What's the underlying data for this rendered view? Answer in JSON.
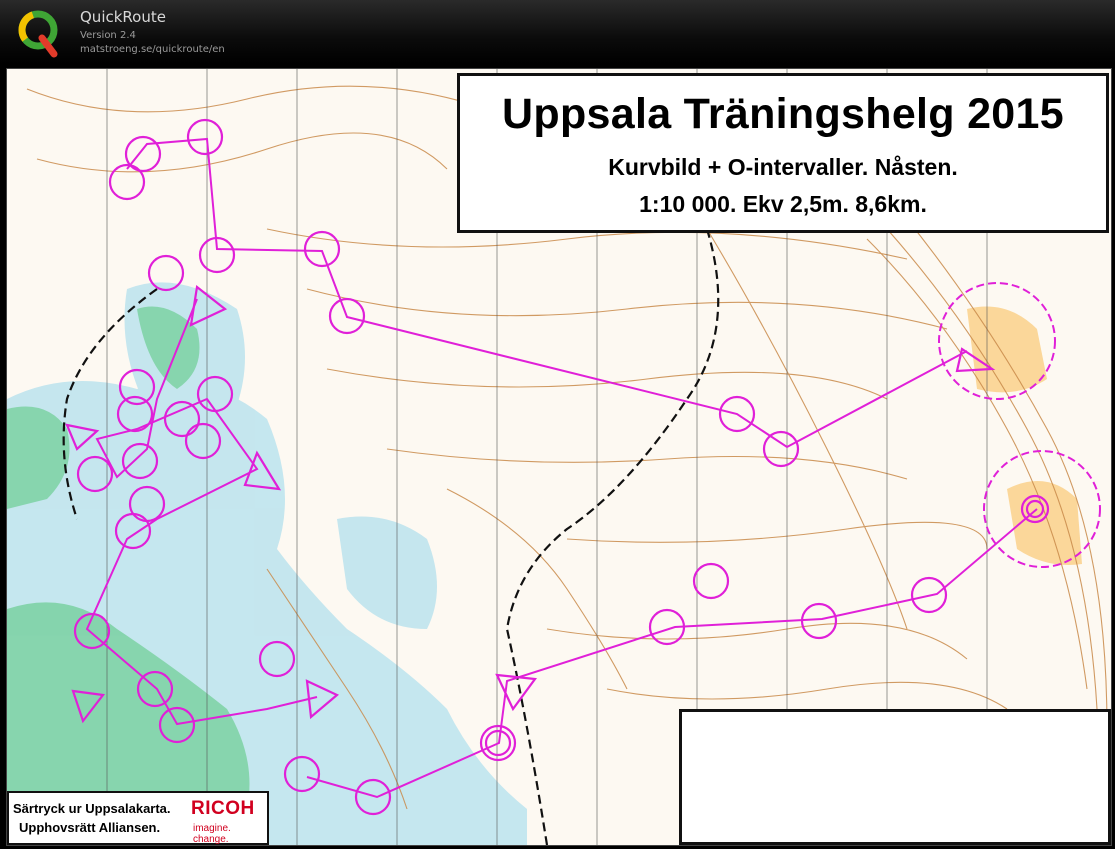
{
  "app": {
    "name": "QuickRoute",
    "version": "Version 2.4",
    "url": "matstroeng.se/quickroute/en"
  },
  "map": {
    "title": "Uppsala Träningshelg 2015",
    "subtitle_line1": "Kurvbild + O-intervaller. Nåsten.",
    "subtitle_line2": "1:10 000. Ekv 2,5m. 8,6km.",
    "credit_line1": "Särtryck ur Uppsalakarta.",
    "credit_line2": "Upphovsrätt Alliansen.",
    "sponsor_name": "RICOH",
    "sponsor_tagline": "imagine. change."
  },
  "colors": {
    "course_magenta": "#e020d8",
    "contour_brown": "#c98a4a",
    "marsh_blue": "#bfe4ee",
    "green_vegetation": "#7fd3a6",
    "open_land_yellow": "#fbd79a"
  },
  "icons": {
    "app_logo": "quickroute-q-logo"
  }
}
